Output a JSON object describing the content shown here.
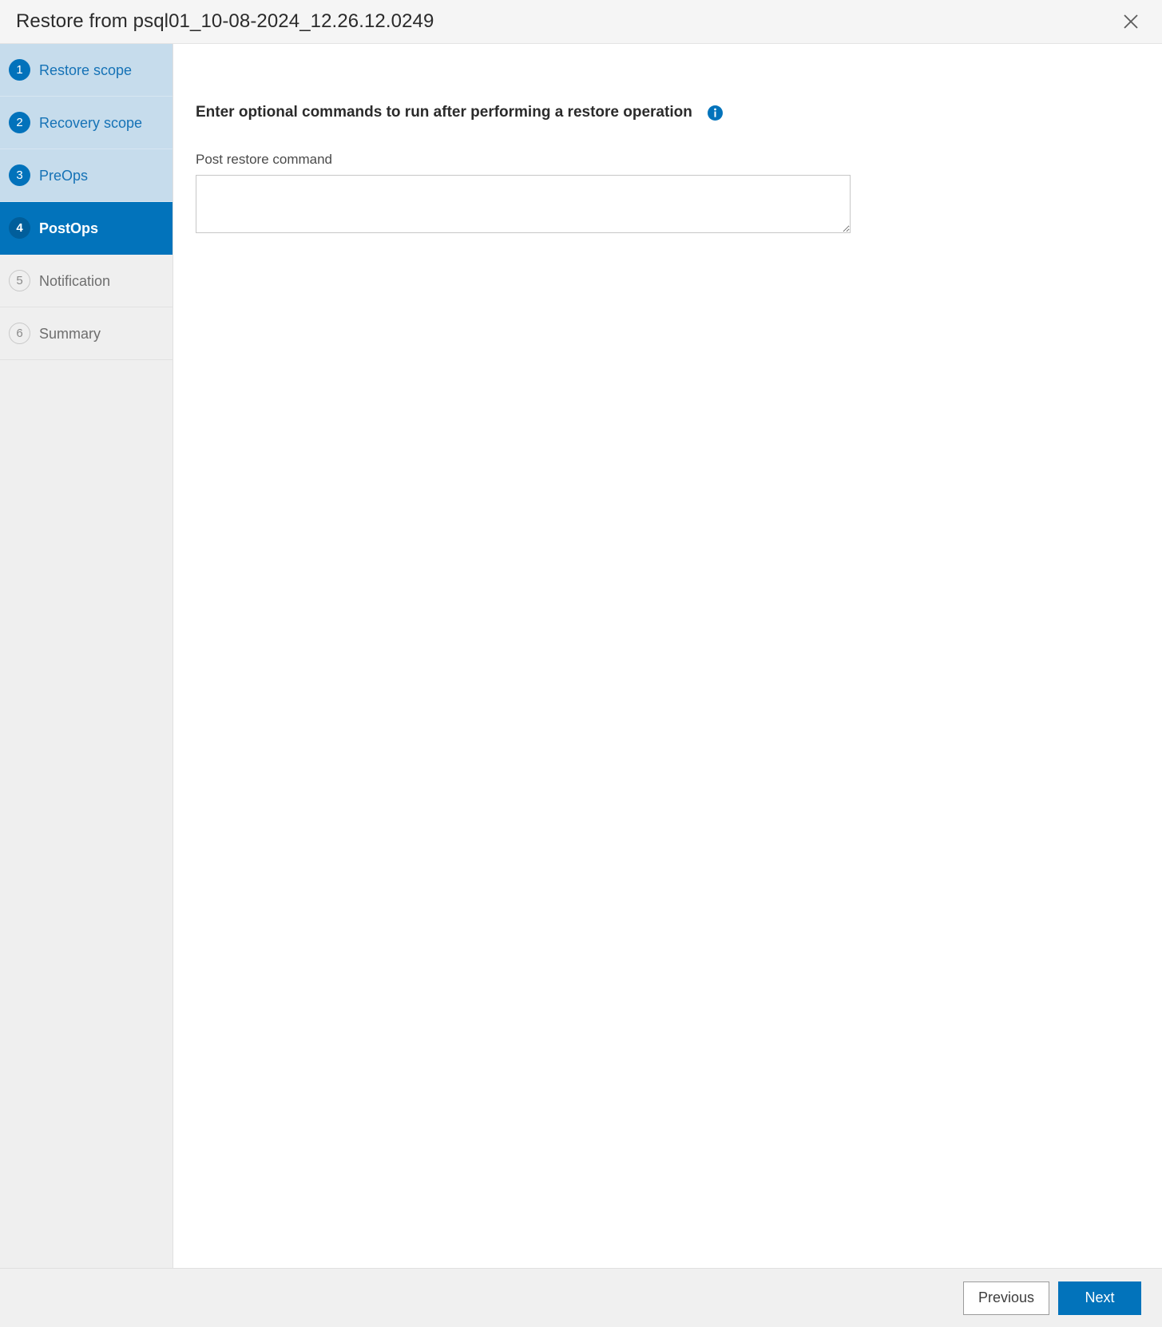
{
  "dialog": {
    "title": "Restore from psql01_10-08-2024_12.26.12.0249",
    "close_icon": "close-icon"
  },
  "sidebar": {
    "steps": [
      {
        "number": "1",
        "label": "Restore scope",
        "state": "done"
      },
      {
        "number": "2",
        "label": "Recovery scope",
        "state": "done"
      },
      {
        "number": "3",
        "label": "PreOps",
        "state": "done"
      },
      {
        "number": "4",
        "label": "PostOps",
        "state": "active"
      },
      {
        "number": "5",
        "label": "Notification",
        "state": "todo"
      },
      {
        "number": "6",
        "label": "Summary",
        "state": "todo"
      }
    ]
  },
  "main": {
    "heading": "Enter optional commands to run after performing a restore operation",
    "info_icon": "info-icon",
    "field": {
      "label": "Post restore command",
      "value": "",
      "placeholder": ""
    }
  },
  "footer": {
    "previous_label": "Previous",
    "next_label": "Next"
  },
  "colors": {
    "accent": "#0273bb",
    "step_done_bg": "#c6dcec",
    "step_todo_bg": "#efefef",
    "titlebar_bg": "#f5f5f5",
    "footer_bg": "#f0f0f0"
  }
}
